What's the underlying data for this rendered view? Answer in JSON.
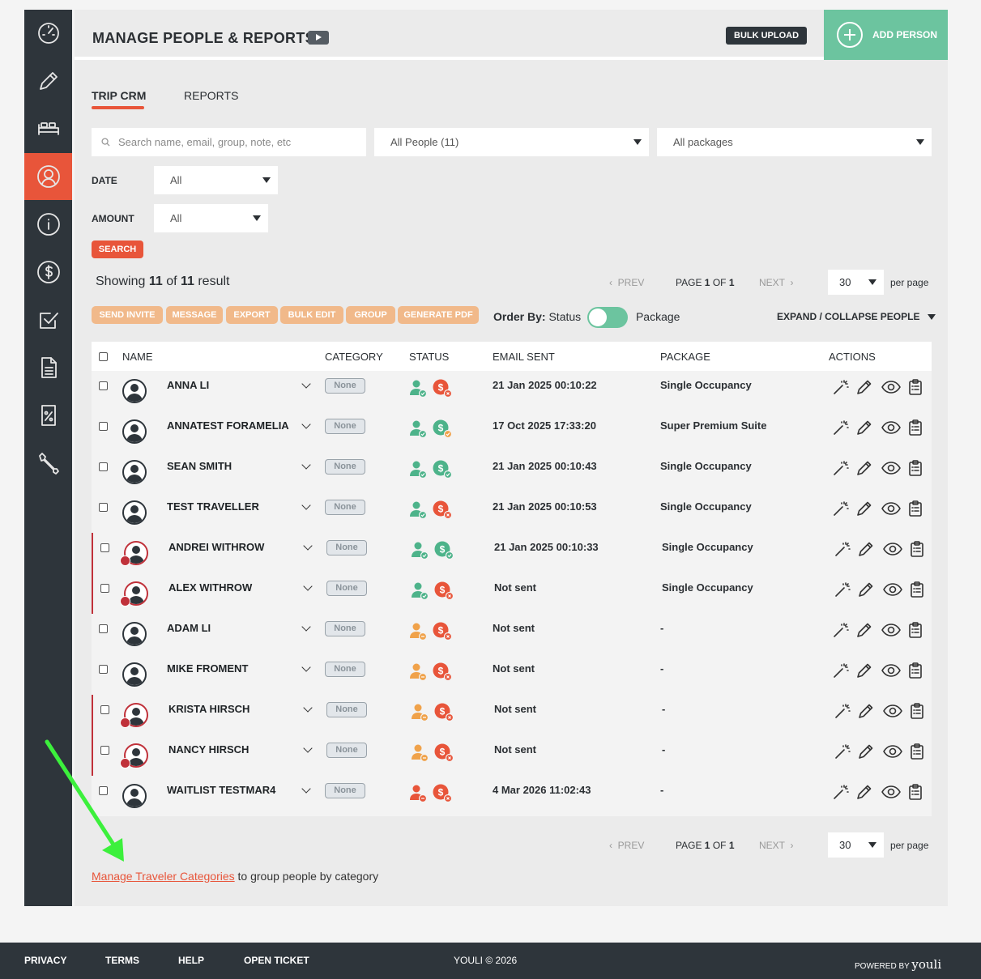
{
  "header": {
    "title": "MANAGE PEOPLE & REPORTS",
    "bulk_upload": "BULK UPLOAD",
    "add_person": "ADD PERSON"
  },
  "sidebar": {
    "items": [
      {
        "name": "dashboard",
        "icon": "speedometer-icon"
      },
      {
        "name": "edit",
        "icon": "pencil-icon"
      },
      {
        "name": "accommodation",
        "icon": "bed-icon"
      },
      {
        "name": "people",
        "icon": "people-icon",
        "active": true
      },
      {
        "name": "info",
        "icon": "info-icon"
      },
      {
        "name": "payments",
        "icon": "dollar-icon"
      },
      {
        "name": "tasks",
        "icon": "checkbox-icon"
      },
      {
        "name": "documents",
        "icon": "document-icon"
      },
      {
        "name": "discounts",
        "icon": "coupon-icon"
      },
      {
        "name": "settings",
        "icon": "wrench-icon"
      }
    ]
  },
  "tabs": {
    "trip_crm": "TRIP CRM",
    "reports": "REPORTS"
  },
  "filters": {
    "search_placeholder": "Search name, email, group, note, etc",
    "people": "All People (11)",
    "packages": "All packages",
    "date_label": "DATE",
    "date_value": "All",
    "amount_label": "AMOUNT",
    "amount_value": "All",
    "search_button": "SEARCH"
  },
  "results": {
    "prefix": "Showing ",
    "shown": "11",
    "of": " of ",
    "total": "11",
    "suffix": " result"
  },
  "pagination": {
    "prev": "PREV",
    "page_label": "PAGE ",
    "page": "1",
    "of_label": " OF ",
    "pages": "1",
    "next": "NEXT",
    "per_page_value": "30",
    "per_page": "per page"
  },
  "actions": {
    "send_invite": "SEND INVITE",
    "message": "MESSAGE",
    "export": "EXPORT",
    "bulk_edit": "BULK EDIT",
    "group": "GROUP",
    "generate_pdf": "GENERATE PDF"
  },
  "order_by": {
    "label": "Order By:",
    "status": "Status",
    "package": "Package"
  },
  "expand": "EXPAND / COLLAPSE PEOPLE",
  "table": {
    "headers": {
      "name": "NAME",
      "category": "CATEGORY",
      "status": "STATUS",
      "email": "EMAIL SENT",
      "package": "PACKAGE",
      "actions": "ACTIONS"
    },
    "rows": [
      {
        "name": "ANNA LI",
        "category": "None",
        "person": "confirmed",
        "pay": "unpaid",
        "email": "21 Jan 2025 00:10:22",
        "package": "Single Occupancy",
        "group": false
      },
      {
        "name": "ANNATEST FORAMELIA",
        "category": "None",
        "person": "confirmed",
        "pay": "partial",
        "email": "17 Oct 2025 17:33:20",
        "package": "Super Premium Suite",
        "group": false
      },
      {
        "name": "SEAN SMITH",
        "category": "None",
        "person": "confirmed",
        "pay": "paid",
        "email": "21 Jan 2025 00:10:43",
        "package": "Single Occupancy",
        "group": false
      },
      {
        "name": "TEST TRAVELLER",
        "category": "None",
        "person": "confirmed",
        "pay": "unpaid",
        "email": "21 Jan 2025 00:10:53",
        "package": "Single Occupancy",
        "group": false
      },
      {
        "name": "ANDREI WITHROW",
        "category": "None",
        "person": "confirmed",
        "pay": "paid",
        "email": "21 Jan 2025 00:10:33",
        "package": "Single Occupancy",
        "group": true
      },
      {
        "name": "ALEX WITHROW",
        "category": "None",
        "person": "confirmed",
        "pay": "unpaid",
        "email": "Not sent",
        "package": "Single Occupancy",
        "group": true
      },
      {
        "name": "ADAM LI",
        "category": "None",
        "person": "pending",
        "pay": "unpaid",
        "email": "Not sent",
        "package": "-",
        "group": false
      },
      {
        "name": "MIKE FROMENT",
        "category": "None",
        "person": "pending",
        "pay": "unpaid",
        "email": "Not sent",
        "package": "-",
        "group": false
      },
      {
        "name": "KRISTA HIRSCH",
        "category": "None",
        "person": "pending",
        "pay": "unpaid",
        "email": "Not sent",
        "package": "-",
        "group": true
      },
      {
        "name": "NANCY HIRSCH",
        "category": "None",
        "person": "pending",
        "pay": "unpaid",
        "email": "Not sent",
        "package": "-",
        "group": true
      },
      {
        "name": "WAITLIST TESTMAR4",
        "category": "None",
        "person": "waitlist",
        "pay": "unpaid",
        "email": "4 Mar 2026 11:02:43",
        "package": "-",
        "group": false
      }
    ]
  },
  "manage": {
    "link": "Manage Traveler Categories",
    "rest": " to group people by category"
  },
  "footer": {
    "privacy": "PRIVACY",
    "terms": "TERMS",
    "help": "HELP",
    "open_ticket": "OPEN TICKET",
    "copyright": "YOULI © 2026",
    "powered_by": "POWERED BY",
    "brand": "youli"
  },
  "colors": {
    "accent": "#e8553a",
    "green": "#6cc49f",
    "sidebar": "#2e353b",
    "orange": "#f1b98a",
    "paid": "#4db38a",
    "pending": "#f0a24a",
    "unpaid": "#e8553a"
  }
}
